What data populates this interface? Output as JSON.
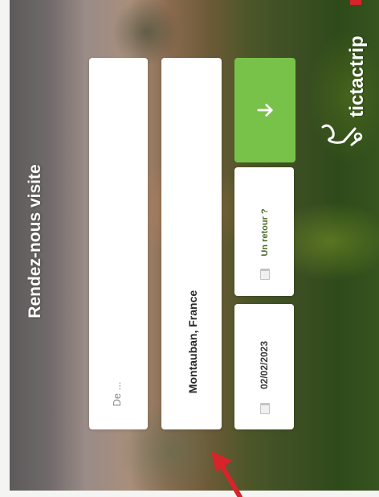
{
  "page": {
    "headline": "Rendez-nous visite",
    "brand": "tictactrip"
  },
  "search": {
    "from_placeholder": "De ...",
    "to_value": "Montauban, France",
    "date_value": "02/02/2023",
    "return_label": "Un retour ?",
    "submit_icon": "arrow-up-icon"
  },
  "colors": {
    "accent": "#79c24a",
    "annotation": "#d8232a"
  }
}
